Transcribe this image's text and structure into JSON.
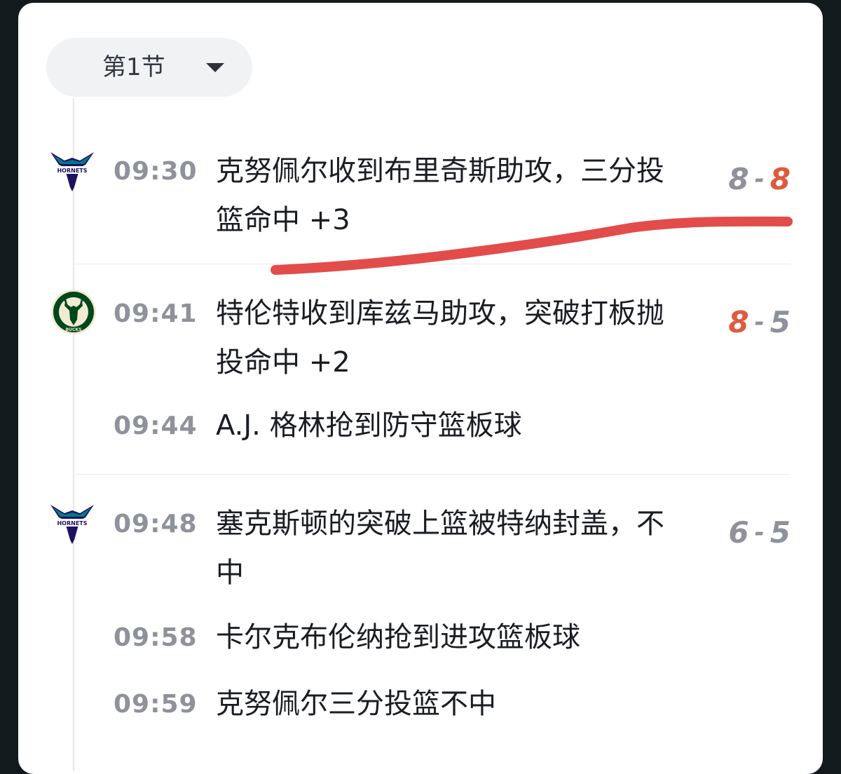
{
  "period_selector": {
    "label": "第1节",
    "icon": "caret-down-icon"
  },
  "colors": {
    "background": "#121a1d",
    "card": "#ffffff",
    "score_highlight": "#e05a3f",
    "time_text": "#8d929b",
    "annotation": "#e24c4a",
    "hornets_purple": "#1d1160",
    "bucks_green": "#00471b"
  },
  "events": [
    {
      "team": "hornets-logo",
      "time": "09:30",
      "text": "克努佩尔收到布里奇斯助攻，三分投篮命中  +3",
      "score": {
        "left": "8",
        "sep": "-",
        "right": "8",
        "highlight": "right"
      }
    },
    {
      "team": "bucks-logo",
      "time": "09:41",
      "text": "特伦特收到库兹马助攻，突破打板抛投命中  +2",
      "score": {
        "left": "8",
        "sep": "-",
        "right": "5",
        "highlight": "left"
      }
    },
    {
      "team": "",
      "time": "09:44",
      "text": "A.J. 格林抢到防守篮板球"
    },
    {
      "team": "hornets-logo",
      "time": "09:48",
      "text": "塞克斯顿的突破上篮被特纳封盖，不中",
      "score": {
        "left": "6",
        "sep": "-",
        "right": "5",
        "highlight": "none"
      }
    },
    {
      "team": "",
      "time": "09:58",
      "text": "卡尔克布伦纳抢到进攻篮板球"
    },
    {
      "team": "",
      "time": "09:59",
      "text": "克努佩尔三分投篮不中"
    }
  ]
}
